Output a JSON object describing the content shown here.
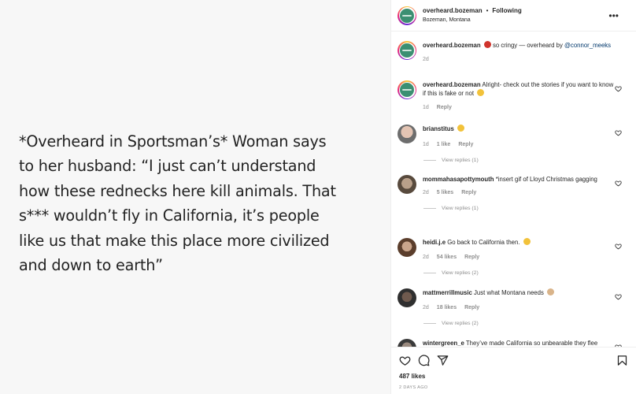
{
  "post": {
    "image_text": "*Overheard in Sportsman’s* Woman says\nto her husband: “I just can’t understand\nhow these rednecks here kill animals. That\ns*** wouldn’t fly in California, it’s people\nlike us that make this place more civilized\nand down to earth”"
  },
  "header": {
    "username": "overheard.bozeman",
    "separator": "•",
    "follow_label": "Following",
    "location": "Bozeman, Montana",
    "more_icon": "•••"
  },
  "caption": {
    "username": "overheard.bozeman",
    "text": " so cringy — overheard by ",
    "mention": "@connor_meeks",
    "age": "2d"
  },
  "comments": [
    {
      "username": "overheard.bozeman",
      "text": " Alright- check out the stories if you want to know if this is fake or not",
      "age": "1d",
      "likes": "",
      "reply": "Reply",
      "view_replies": ""
    },
    {
      "username": "brianstitus",
      "text": "",
      "age": "1d",
      "likes": "1 like",
      "reply": "Reply",
      "view_replies": "View replies (1)"
    },
    {
      "username": "mommahasapottymouth",
      "text": " *insert gif of Lloyd Christmas gagging",
      "age": "2d",
      "likes": "5 likes",
      "reply": "Reply",
      "view_replies": "View replies (1)"
    },
    {
      "username": "heidi.j.e",
      "text": " Go back to California then.",
      "age": "2d",
      "likes": "54 likes",
      "reply": "Reply",
      "view_replies": "View replies (2)"
    },
    {
      "username": "mattmerrillmusic",
      "text": " Just what Montana needs",
      "age": "2d",
      "likes": "18 likes",
      "reply": "Reply",
      "view_replies": "View replies (2)"
    },
    {
      "username": "wintergreen_e",
      "text": " They’ve made California so unbearable they flee",
      "age": "",
      "likes": "",
      "reply": "",
      "view_replies": ""
    }
  ],
  "actions": {
    "likes": "487 likes",
    "post_age": "2 DAYS AGO"
  },
  "icons": [
    "heart-icon",
    "comment-icon",
    "share-icon",
    "bookmark-icon",
    "more-icon"
  ],
  "colors": {
    "link": "#00376b",
    "muted": "#8e8e8e",
    "text": "#262626"
  }
}
